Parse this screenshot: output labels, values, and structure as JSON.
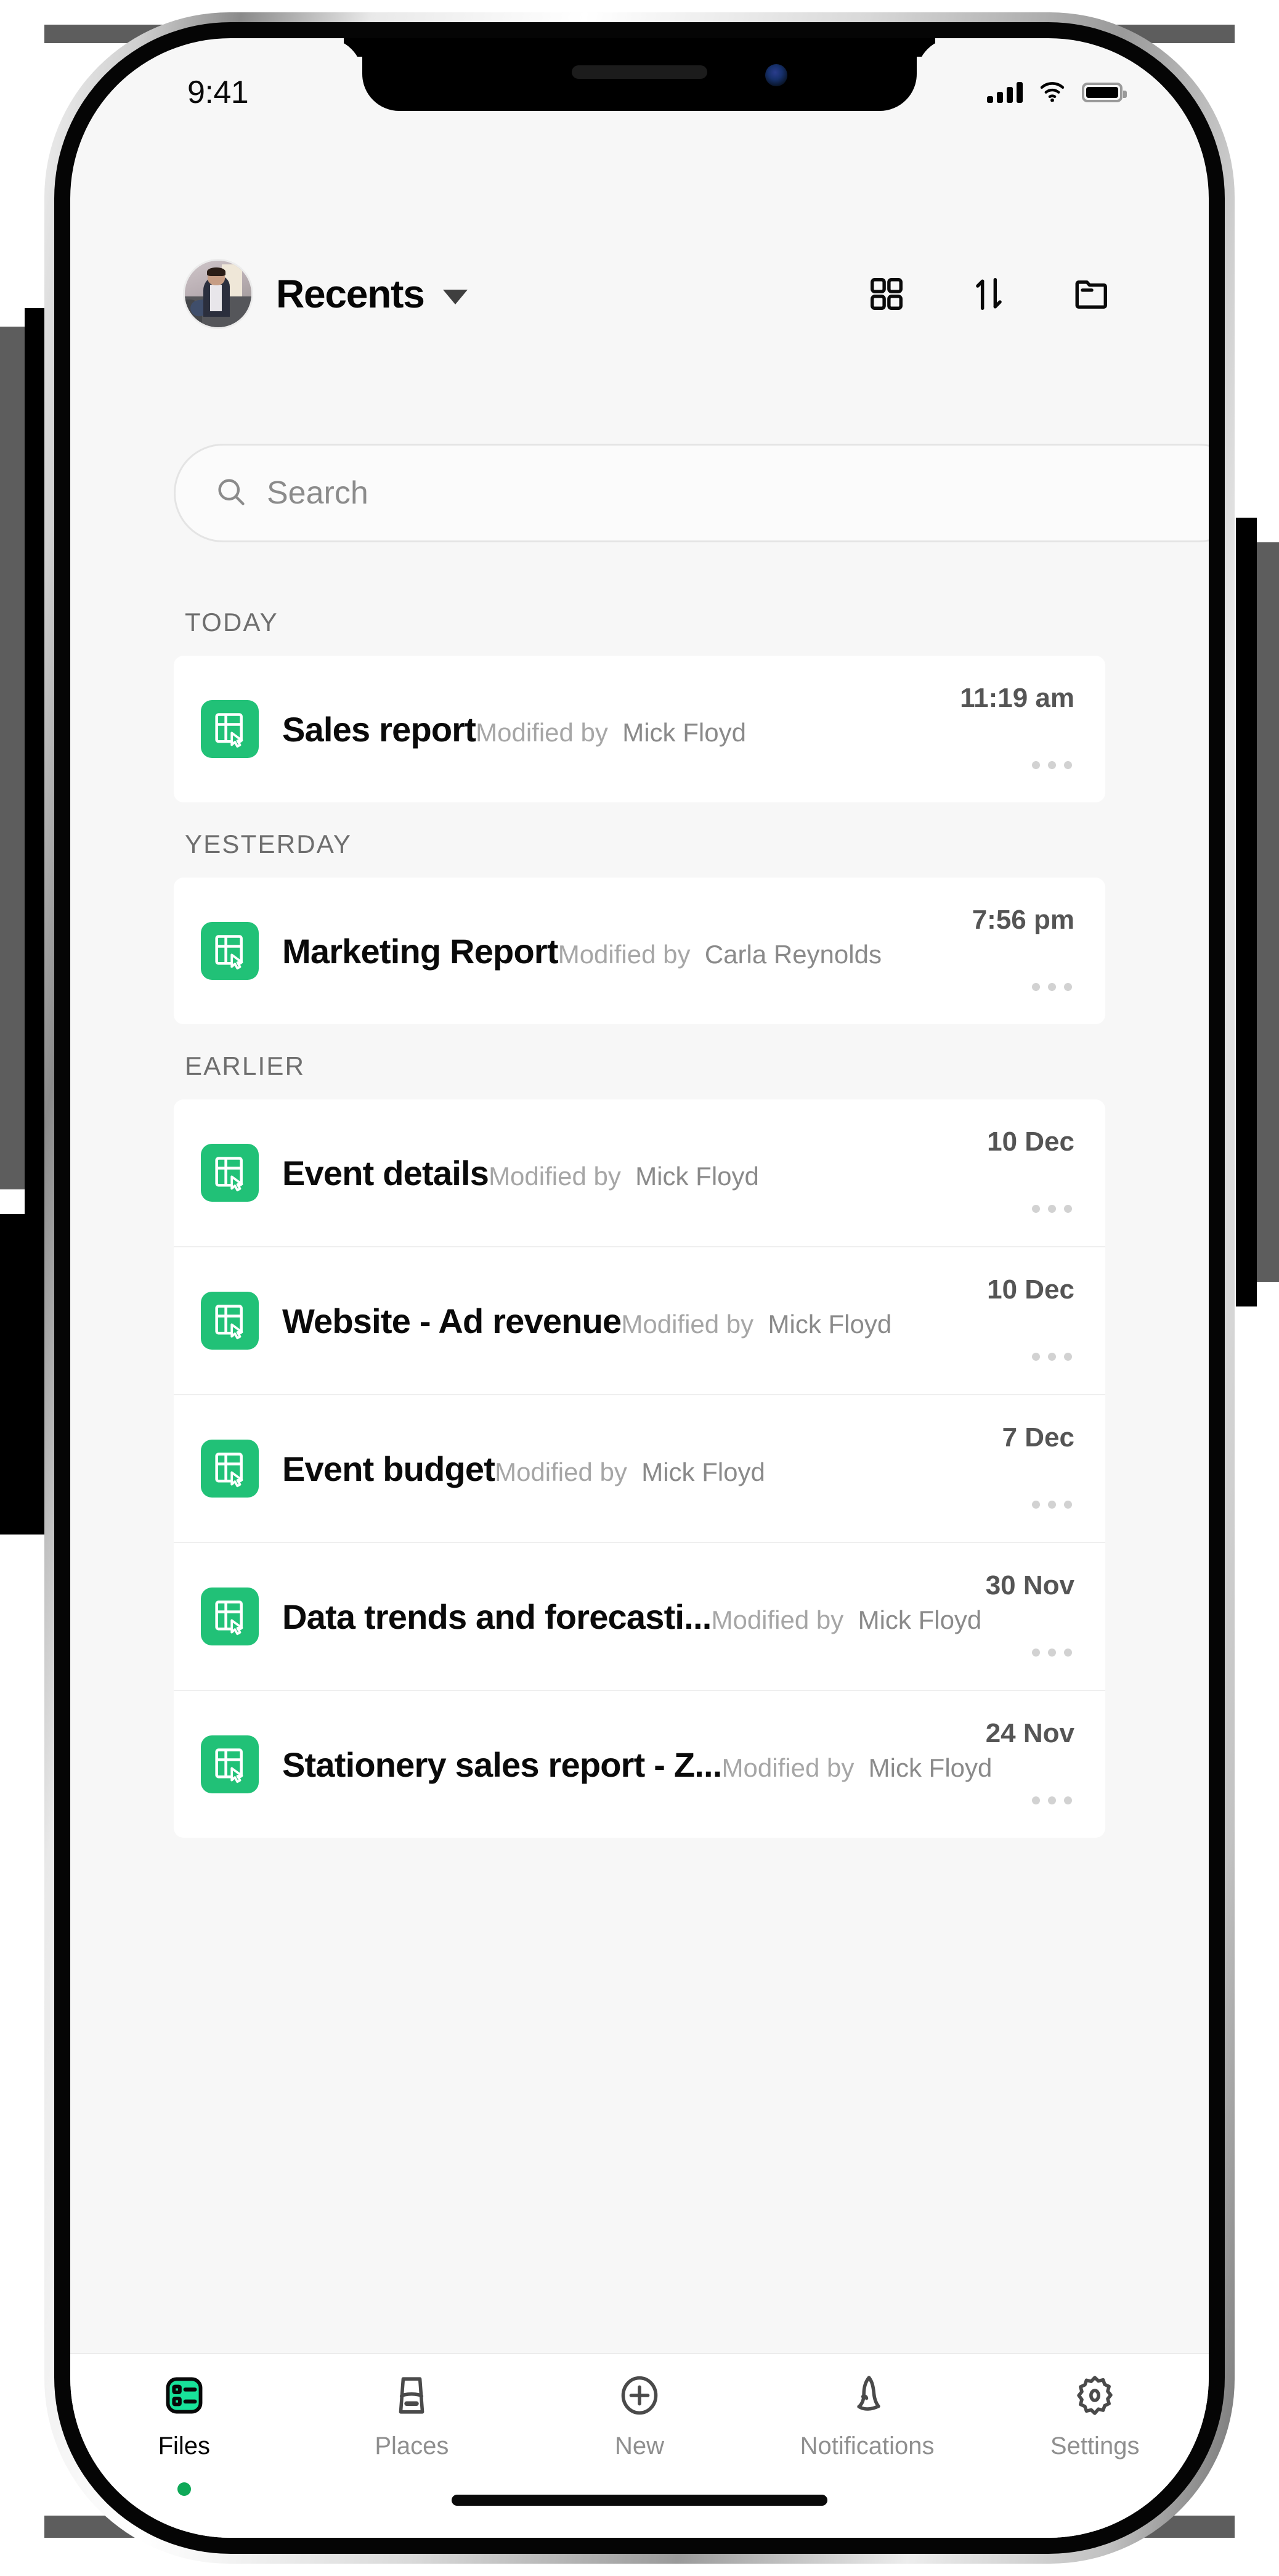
{
  "status_bar": {
    "time": "9:41",
    "signal_icon": "cellular-bars-icon",
    "wifi_icon": "wifi-icon",
    "battery_icon": "battery-full-icon"
  },
  "header": {
    "avatar_name": "user-avatar",
    "title": "Recents",
    "dropdown_icon": "chevron-down-icon",
    "actions": [
      {
        "name": "grid-view-button",
        "icon": "grid-icon"
      },
      {
        "name": "sort-button",
        "icon": "sort-arrows-icon"
      },
      {
        "name": "folder-button",
        "icon": "folder-icon"
      }
    ]
  },
  "search": {
    "placeholder": "Search",
    "value": "",
    "icon": "search-icon"
  },
  "sections": [
    {
      "label": "TODAY",
      "files": [
        {
          "title": "Sales report",
          "modified_prefix": "Modified by",
          "modified_by": "Mick Floyd",
          "time": "11:19 am",
          "icon": "spreadsheet-icon",
          "more_icon": "more-options-icon"
        }
      ]
    },
    {
      "label": "YESTERDAY",
      "files": [
        {
          "title": "Marketing Report",
          "modified_prefix": "Modified by",
          "modified_by": "Carla Reynolds",
          "time": "7:56 pm",
          "icon": "spreadsheet-icon",
          "more_icon": "more-options-icon"
        }
      ]
    },
    {
      "label": "EARLIER",
      "files": [
        {
          "title": "Event details",
          "modified_prefix": "Modified by",
          "modified_by": "Mick Floyd",
          "time": "10 Dec",
          "icon": "spreadsheet-icon",
          "more_icon": "more-options-icon"
        },
        {
          "title": "Website - Ad revenue",
          "modified_prefix": "Modified by",
          "modified_by": "Mick Floyd",
          "time": "10 Dec",
          "icon": "spreadsheet-icon",
          "more_icon": "more-options-icon"
        },
        {
          "title": "Event budget",
          "modified_prefix": "Modified by",
          "modified_by": "Mick Floyd",
          "time": "7 Dec",
          "icon": "spreadsheet-icon",
          "more_icon": "more-options-icon"
        },
        {
          "title": "Data trends and forecasti...",
          "modified_prefix": "Modified by",
          "modified_by": "Mick Floyd",
          "time": "30 Nov",
          "icon": "spreadsheet-icon",
          "more_icon": "more-options-icon"
        },
        {
          "title": "Stationery sales report - Z...",
          "modified_prefix": "Modified by",
          "modified_by": "Mick Floyd",
          "time": "24 Nov",
          "icon": "spreadsheet-icon",
          "more_icon": "more-options-icon"
        }
      ]
    }
  ],
  "tabs": [
    {
      "label": "Files",
      "icon": "files-icon",
      "active": true
    },
    {
      "label": "Places",
      "icon": "places-icon",
      "active": false
    },
    {
      "label": "New",
      "icon": "plus-circle-icon",
      "active": false
    },
    {
      "label": "Notifications",
      "icon": "bell-icon",
      "active": false
    },
    {
      "label": "Settings",
      "icon": "gear-icon",
      "active": false
    }
  ],
  "colors": {
    "accent_green": "#21c177",
    "active_dot": "#0fa958",
    "screen_bg": "#f7f7f7",
    "card_bg": "#ffffff"
  }
}
